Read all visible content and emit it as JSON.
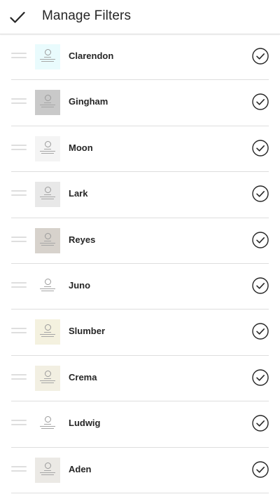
{
  "header": {
    "title": "Manage Filters",
    "done_icon": "checkmark-icon"
  },
  "filters": [
    {
      "label": "Clarendon",
      "thumb_color": "#e9fbfd"
    },
    {
      "label": "Gingham",
      "thumb_color": "#c9c9c9"
    },
    {
      "label": "Moon",
      "thumb_color": "#f4f4f4"
    },
    {
      "label": "Lark",
      "thumb_color": "#e8e8e8"
    },
    {
      "label": "Reyes",
      "thumb_color": "#d7d2cc"
    },
    {
      "label": "Juno",
      "thumb_color": "#ffffff"
    },
    {
      "label": "Slumber",
      "thumb_color": "#f4f1df"
    },
    {
      "label": "Crema",
      "thumb_color": "#f2efe2"
    },
    {
      "label": "Ludwig",
      "thumb_color": "#ffffff"
    },
    {
      "label": "Aden",
      "thumb_color": "#ebe9e5"
    }
  ],
  "colors": {
    "divider": "#dedede",
    "text": "#262626",
    "drag_handle": "#dedede"
  }
}
